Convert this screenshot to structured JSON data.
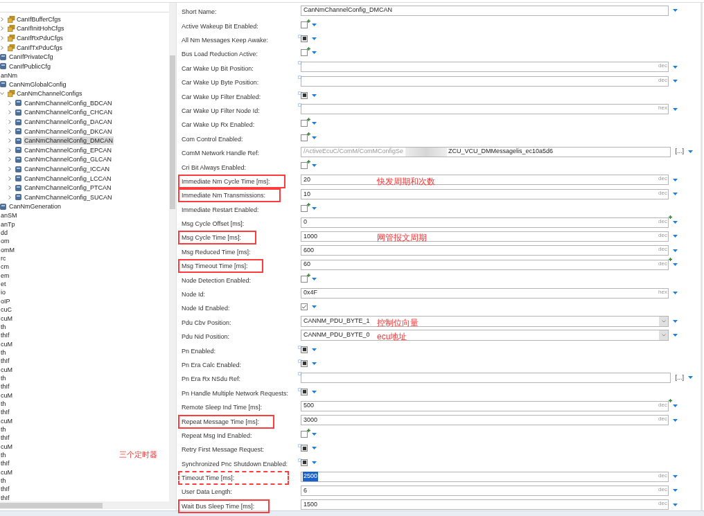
{
  "tree": [
    {
      "label": "CanIfBufferCfgs",
      "kind": "container",
      "expanded": false
    },
    {
      "label": "CanIfInitHohCfgs",
      "kind": "container",
      "expanded": false
    },
    {
      "label": "CanIfRxPduCfgs",
      "kind": "container",
      "expanded": false
    },
    {
      "label": "CanIfTxPduCfgs",
      "kind": "container",
      "expanded": false
    },
    {
      "label": "CanIfPrivateCfg",
      "kind": "item"
    },
    {
      "label": "CanIfPublicCfg",
      "kind": "item"
    },
    {
      "label": "anNm",
      "children": [
        {
          "label": "CanNmGlobalConfig",
          "kind": "item"
        },
        {
          "label": "CanNmChannelConfigs",
          "kind": "container",
          "expanded": true,
          "children": [
            {
              "label": "CanNmChannelConfig_BDCAN",
              "kind": "item",
              "expanded": false,
              "selected": false
            },
            {
              "label": "CanNmChannelConfig_CHCAN",
              "kind": "item",
              "expanded": false,
              "selected": false
            },
            {
              "label": "CanNmChannelConfig_DACAN",
              "kind": "item",
              "expanded": false,
              "selected": false
            },
            {
              "label": "CanNmChannelConfig_DKCAN",
              "kind": "item",
              "expanded": false,
              "selected": false
            },
            {
              "label": "CanNmChannelConfig_DMCAN",
              "kind": "item",
              "expanded": false,
              "selected": true
            },
            {
              "label": "CanNmChannelConfig_EPCAN",
              "kind": "item",
              "expanded": false,
              "selected": false
            },
            {
              "label": "CanNmChannelConfig_GLCAN",
              "kind": "item",
              "expanded": false,
              "selected": false
            },
            {
              "label": "CanNmChannelConfig_ICCAN",
              "kind": "item",
              "expanded": false,
              "selected": false
            },
            {
              "label": "CanNmChannelConfig_LCCAN",
              "kind": "item",
              "expanded": false,
              "selected": false
            },
            {
              "label": "CanNmChannelConfig_PTCAN",
              "kind": "item",
              "expanded": false,
              "selected": false
            },
            {
              "label": "CanNmChannelConfig_SUCAN",
              "kind": "item",
              "expanded": false,
              "selected": false
            }
          ]
        },
        {
          "label": "CanNmGeneration",
          "kind": "item"
        }
      ]
    },
    {
      "label": "anSM"
    },
    {
      "label": "anTp"
    },
    {
      "label": "dd"
    },
    {
      "label": "om"
    },
    {
      "label": "omM"
    },
    {
      "label": "rc"
    },
    {
      "label": "cm"
    },
    {
      "label": "em"
    },
    {
      "label": "et"
    },
    {
      "label": "io"
    },
    {
      "label": "oIP"
    },
    {
      "label": "cuC"
    },
    {
      "label": "cuM"
    },
    {
      "label": "th"
    },
    {
      "label": "thIf"
    },
    {
      "label": "cuM"
    },
    {
      "label": "th"
    },
    {
      "label": "thIf"
    },
    {
      "label": "cuM"
    },
    {
      "label": "th"
    },
    {
      "label": "thIf"
    },
    {
      "label": "cuM"
    },
    {
      "label": "th"
    },
    {
      "label": "thIf"
    },
    {
      "label": "cuM"
    },
    {
      "label": "th"
    },
    {
      "label": "thIf"
    },
    {
      "label": "cuM"
    },
    {
      "label": "th"
    },
    {
      "label": "thIf"
    },
    {
      "label": "cuM"
    },
    {
      "label": "th"
    },
    {
      "label": "thIf"
    },
    {
      "label": "thIf"
    }
  ],
  "tree_note": "三个定时器",
  "rows": [
    {
      "label": "Short Name:",
      "kind": "text",
      "value": "CanNmChannelConfig_DMCAN"
    },
    {
      "label": "Active Wakeup Bit Enabled:",
      "kind": "checkbox",
      "checked": false,
      "user_defined": true
    },
    {
      "label": "All Nm Messages Keep Awake:",
      "kind": "checkbox",
      "checked": true,
      "derived": true
    },
    {
      "label": "Bus Load Reduction Active:",
      "kind": "checkbox",
      "checked": false,
      "user_defined": true
    },
    {
      "label": "Car Wake Up Bit Position:",
      "kind": "text",
      "unit": "dec",
      "derived": true
    },
    {
      "label": "Car Wake Up Byte Position:",
      "kind": "text",
      "unit": "dec",
      "derived": true
    },
    {
      "label": "Car Wake Up Filter Enabled:",
      "kind": "checkbox",
      "checked": true,
      "derived": true
    },
    {
      "label": "Car Wake Up Filter Node Id:",
      "kind": "text",
      "unit": "hex",
      "derived": true
    },
    {
      "label": "Car Wake Up Rx Enabled:",
      "kind": "checkbox",
      "checked": false,
      "user_defined": true
    },
    {
      "label": "Com Control Enabled:",
      "kind": "checkbox",
      "checked": false,
      "user_defined": true
    },
    {
      "label": "ComM Network Handle Ref:",
      "kind": "reference",
      "path": "/ActiveEcuC/ComM/ComMConfigSe",
      "value": "ZCU_VCU_DMMessagelis_ec10a5d6",
      "button": "[...]"
    },
    {
      "label": "Cri Bit Always Enabled:",
      "kind": "checkbox",
      "checked": false,
      "user_defined": true
    },
    {
      "label": "Immediate Nm Cycle Time [ms]:",
      "kind": "text",
      "value": "20",
      "unit": "dec",
      "boxed": true,
      "note": "快发周期和次数"
    },
    {
      "label": "Immediate Nm Transmissions:",
      "kind": "text",
      "value": "10",
      "unit": "dec",
      "boxed": true
    },
    {
      "label": "Immediate Restart Enabled:",
      "kind": "checkbox",
      "checked": false,
      "user_defined": true
    },
    {
      "label": "Msg Cycle Offset [ms]:",
      "kind": "text",
      "value": "0",
      "unit": "dec",
      "user_defined": true
    },
    {
      "label": "Msg Cycle Time [ms]:",
      "kind": "text",
      "value": "1000",
      "unit": "dec",
      "boxed": true,
      "note": "网管报文周期"
    },
    {
      "label": "Msg Reduced Time [ms]:",
      "kind": "text",
      "value": "600",
      "unit": "dec"
    },
    {
      "label": "Msg Timeout Time [ms]:",
      "kind": "text",
      "value": "60",
      "unit": "dec",
      "user_defined": true,
      "boxed": true
    },
    {
      "label": "Node Detection Enabled:",
      "kind": "checkbox",
      "checked": false,
      "user_defined": true
    },
    {
      "label": "Node Id:",
      "kind": "text",
      "value": "0x4F",
      "unit": "hex"
    },
    {
      "label": "Node Id Enabled:",
      "kind": "checkbox",
      "checked": true
    },
    {
      "label": "Pdu Cbv Position:",
      "kind": "select",
      "value": "CANNM_PDU_BYTE_1",
      "note": "控制位向量"
    },
    {
      "label": "Pdu Nid Position:",
      "kind": "select",
      "value": "CANNM_PDU_BYTE_0",
      "note": "ecu地址"
    },
    {
      "label": "Pn Enabled:",
      "kind": "checkbox",
      "checked": true,
      "derived": true
    },
    {
      "label": "Pn Era Calc Enabled:",
      "kind": "checkbox",
      "checked": true,
      "derived": true
    },
    {
      "label": "Pn Era Rx NSdu Ref:",
      "kind": "reference",
      "derived": true,
      "button": "[...]"
    },
    {
      "label": "Pn Handle Multiple Network Requests:",
      "kind": "checkbox",
      "checked": true,
      "derived": true
    },
    {
      "label": "Remote Sleep Ind Time [ms]:",
      "kind": "text",
      "value": "500",
      "unit": "dec",
      "user_defined": true
    },
    {
      "label": "Repeat Message Time [ms]:",
      "kind": "text",
      "value": "3000",
      "unit": "dec",
      "boxed": true
    },
    {
      "label": "Repeat Msg Ind Enabled:",
      "kind": "checkbox",
      "checked": false,
      "user_defined": true
    },
    {
      "label": "Retry First Message Request:",
      "kind": "checkbox",
      "checked": true,
      "derived": true
    },
    {
      "label": "Synchronized Pnc Shutdown Enabled:",
      "kind": "checkbox",
      "checked": true,
      "derived": true
    },
    {
      "label": "Timeout Time [ms]:",
      "kind": "text",
      "value": "2500",
      "unit": "dec",
      "boxed": true,
      "focused": true
    },
    {
      "label": "User Data Length:",
      "kind": "text",
      "value": "6",
      "unit": "dec"
    },
    {
      "label": "Wait Bus Sleep Time [ms]:",
      "kind": "text",
      "value": "1500",
      "unit": "dec",
      "boxed": true
    }
  ]
}
